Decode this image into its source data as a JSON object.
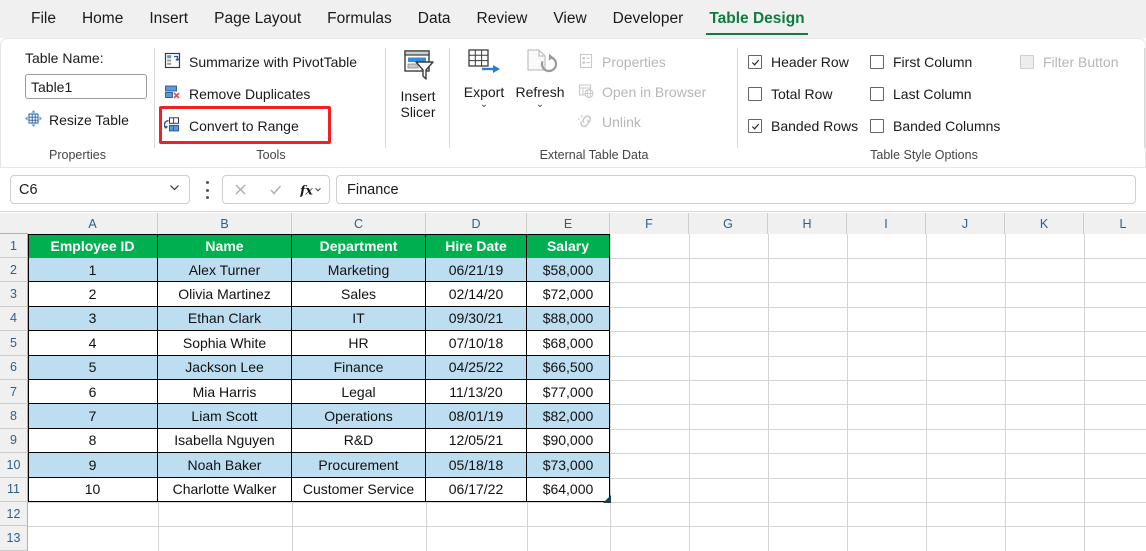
{
  "window": {
    "tabs": [
      {
        "label": "File",
        "active": false
      },
      {
        "label": "Home",
        "active": false
      },
      {
        "label": "Insert",
        "active": false
      },
      {
        "label": "Page Layout",
        "active": false
      },
      {
        "label": "Formulas",
        "active": false
      },
      {
        "label": "Data",
        "active": false
      },
      {
        "label": "Review",
        "active": false
      },
      {
        "label": "View",
        "active": false
      },
      {
        "label": "Developer",
        "active": false
      },
      {
        "label": "Table Design",
        "active": true
      }
    ],
    "active_tab_color": "#107c41"
  },
  "ribbon": {
    "properties": {
      "group_label": "Properties",
      "table_name_label": "Table Name:",
      "table_name_value": "Table1",
      "resize_table_label": "Resize Table"
    },
    "tools": {
      "group_label": "Tools",
      "summarize_label": "Summarize with PivotTable",
      "remove_duplicates_label": "Remove Duplicates",
      "convert_to_range_label": "Convert to Range",
      "highlight_color": "#ee2222",
      "highlighted_item": "Convert to Range"
    },
    "slicer": {
      "insert_slicer_line1": "Insert",
      "insert_slicer_line2": "Slicer"
    },
    "external_table_data": {
      "group_label": "External Table Data",
      "export_label": "Export",
      "refresh_label": "Refresh",
      "properties_label": "Properties",
      "open_in_browser_label": "Open in Browser",
      "unlink_label": "Unlink"
    },
    "table_style_options": {
      "group_label": "Table Style Options",
      "items": [
        {
          "label": "Header Row",
          "checked": true,
          "disabled": false
        },
        {
          "label": "First Column",
          "checked": false,
          "disabled": false
        },
        {
          "label": "Filter Button",
          "checked": false,
          "disabled": true
        },
        {
          "label": "Total Row",
          "checked": false,
          "disabled": false
        },
        {
          "label": "Last Column",
          "checked": false,
          "disabled": false
        },
        {
          "label": "Banded Rows",
          "checked": true,
          "disabled": false
        },
        {
          "label": "Banded Columns",
          "checked": false,
          "disabled": false
        }
      ]
    }
  },
  "formula_bar": {
    "name_box_value": "C6",
    "formula_value": "Finance",
    "cancel_icon": "cross-icon",
    "enter_icon": "check-icon",
    "function_icon": "fx-icon"
  },
  "sheet": {
    "column_headers": [
      "A",
      "B",
      "C",
      "D",
      "E",
      "F",
      "G",
      "H",
      "I",
      "J",
      "K",
      "L"
    ],
    "row_headers": [
      "1",
      "2",
      "3",
      "4",
      "5",
      "6",
      "7",
      "8",
      "9",
      "10",
      "11",
      "12",
      "13"
    ],
    "table": {
      "header_fill": "#00b050",
      "band_fill": "#bdddf0",
      "headers": [
        "Employee ID",
        "Name",
        "Department",
        "Hire Date",
        "Salary"
      ],
      "rows": [
        [
          "1",
          "Alex Turner",
          "Marketing",
          "06/21/19",
          "$58,000"
        ],
        [
          "2",
          "Olivia Martinez",
          "Sales",
          "02/14/20",
          "$72,000"
        ],
        [
          "3",
          "Ethan Clark",
          "IT",
          "09/30/21",
          "$88,000"
        ],
        [
          "4",
          "Sophia White",
          "HR",
          "07/10/18",
          "$68,000"
        ],
        [
          "5",
          "Jackson Lee",
          "Finance",
          "04/25/22",
          "$66,500"
        ],
        [
          "6",
          "Mia Harris",
          "Legal",
          "11/13/20",
          "$77,000"
        ],
        [
          "7",
          "Liam Scott",
          "Operations",
          "08/01/19",
          "$82,000"
        ],
        [
          "8",
          "Isabella Nguyen",
          "R&D",
          "12/05/21",
          "$90,000"
        ],
        [
          "9",
          "Noah Baker",
          "Procurement",
          "05/18/18",
          "$73,000"
        ],
        [
          "10",
          "Charlotte Walker",
          "Customer Service",
          "06/17/22",
          "$64,000"
        ]
      ]
    }
  }
}
